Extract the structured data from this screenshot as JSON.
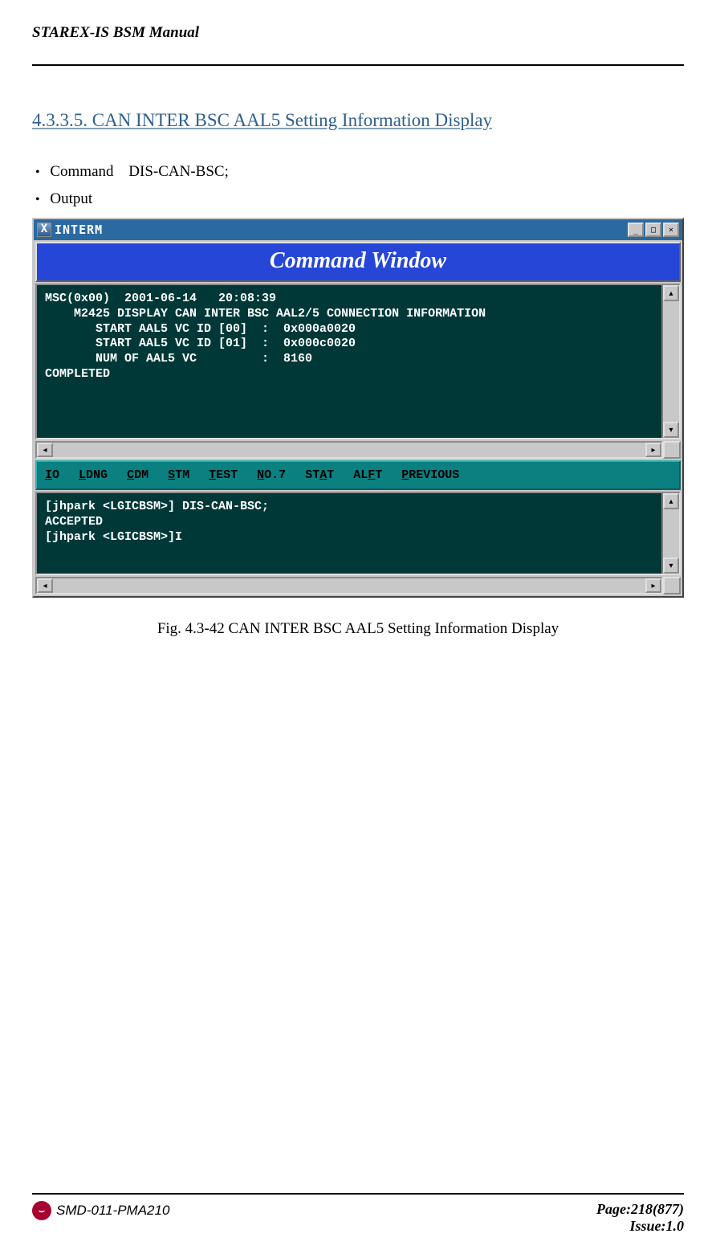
{
  "header": {
    "title": "STAREX-IS BSM Manual"
  },
  "section": {
    "number": "4.3.3.5.",
    "title": "CAN INTER BSC AAL5 Setting Information Display"
  },
  "bullets": {
    "command_label": "Command",
    "command_value": "DIS-CAN-BSC;",
    "output_label": "Output"
  },
  "window": {
    "titlebar_text": "INTERM",
    "banner": "Command Window",
    "output_text": "MSC(0x00)  2001-06-14   20:08:39\n    M2425 DISPLAY CAN INTER BSC AAL2/5 CONNECTION INFORMATION\n       START AAL5 VC ID [00]  :  0x000a0020\n       START AAL5 VC ID [01]  :  0x000c0020\n       NUM OF AAL5 VC         :  8160\nCOMPLETED",
    "menus": {
      "m0": "IO",
      "m1": "LDNG",
      "m2": "CDM",
      "m3": "STM",
      "m4": "TEST",
      "m5": "NO.7",
      "m6": "STAT",
      "m7": "ALFT",
      "m8": "PREVIOUS"
    },
    "cmd_text": "[jhpark <LGICBSM>] DIS-CAN-BSC;\nACCEPTED\n[jhpark <LGICBSM>]I"
  },
  "figure": {
    "caption": "Fig. 4.3-42 CAN INTER BSC AAL5 Setting Information Display"
  },
  "footer": {
    "doc_id": "SMD-011-PMA210",
    "page": "Page:218(877)",
    "issue": "Issue:1.0"
  }
}
